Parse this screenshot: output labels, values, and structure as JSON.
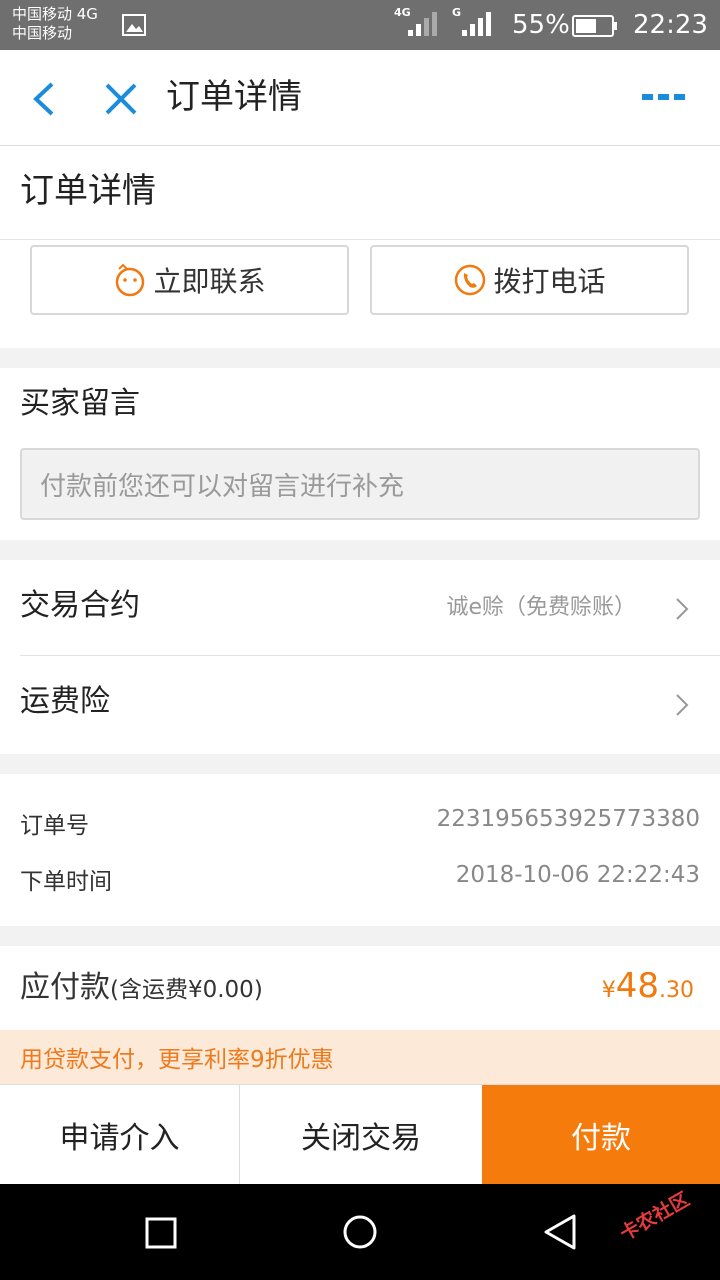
{
  "status_bar": {
    "carrier_line1": "中国移动 4G",
    "carrier_line2": "中国移动",
    "signal1_label": "4G",
    "signal2_label": "G",
    "battery": "55%",
    "time": "22:23"
  },
  "header": {
    "title": "订单详情",
    "accent_color": "#1a8cdc"
  },
  "order_section": {
    "title": "订单详情",
    "contact_button": "立即联系",
    "call_button": "拨打电话"
  },
  "buyer_message": {
    "title": "买家留言",
    "placeholder": "付款前您还可以对留言进行补充"
  },
  "contract": {
    "label": "交易合约",
    "value": "诚e赊（免费赊账）"
  },
  "freight_insurance": {
    "label": "运费险"
  },
  "order_info": {
    "order_no_label": "订单号",
    "order_no": "223195653925773380",
    "order_time_label": "下单时间",
    "order_time": "2018-10-06 22:22:43"
  },
  "payment": {
    "label": "应付款",
    "shipping_note": "(含运费¥0.00)",
    "currency": "¥",
    "amount_int": "48",
    "amount_dec": ".30",
    "color": "#f17a0f"
  },
  "promo": {
    "text": "用贷款支付，更享利率9折优惠"
  },
  "actions": {
    "apply": "申请介入",
    "close": "关闭交易",
    "pay": "付款"
  },
  "watermark": {
    "text": "卡农社区"
  }
}
